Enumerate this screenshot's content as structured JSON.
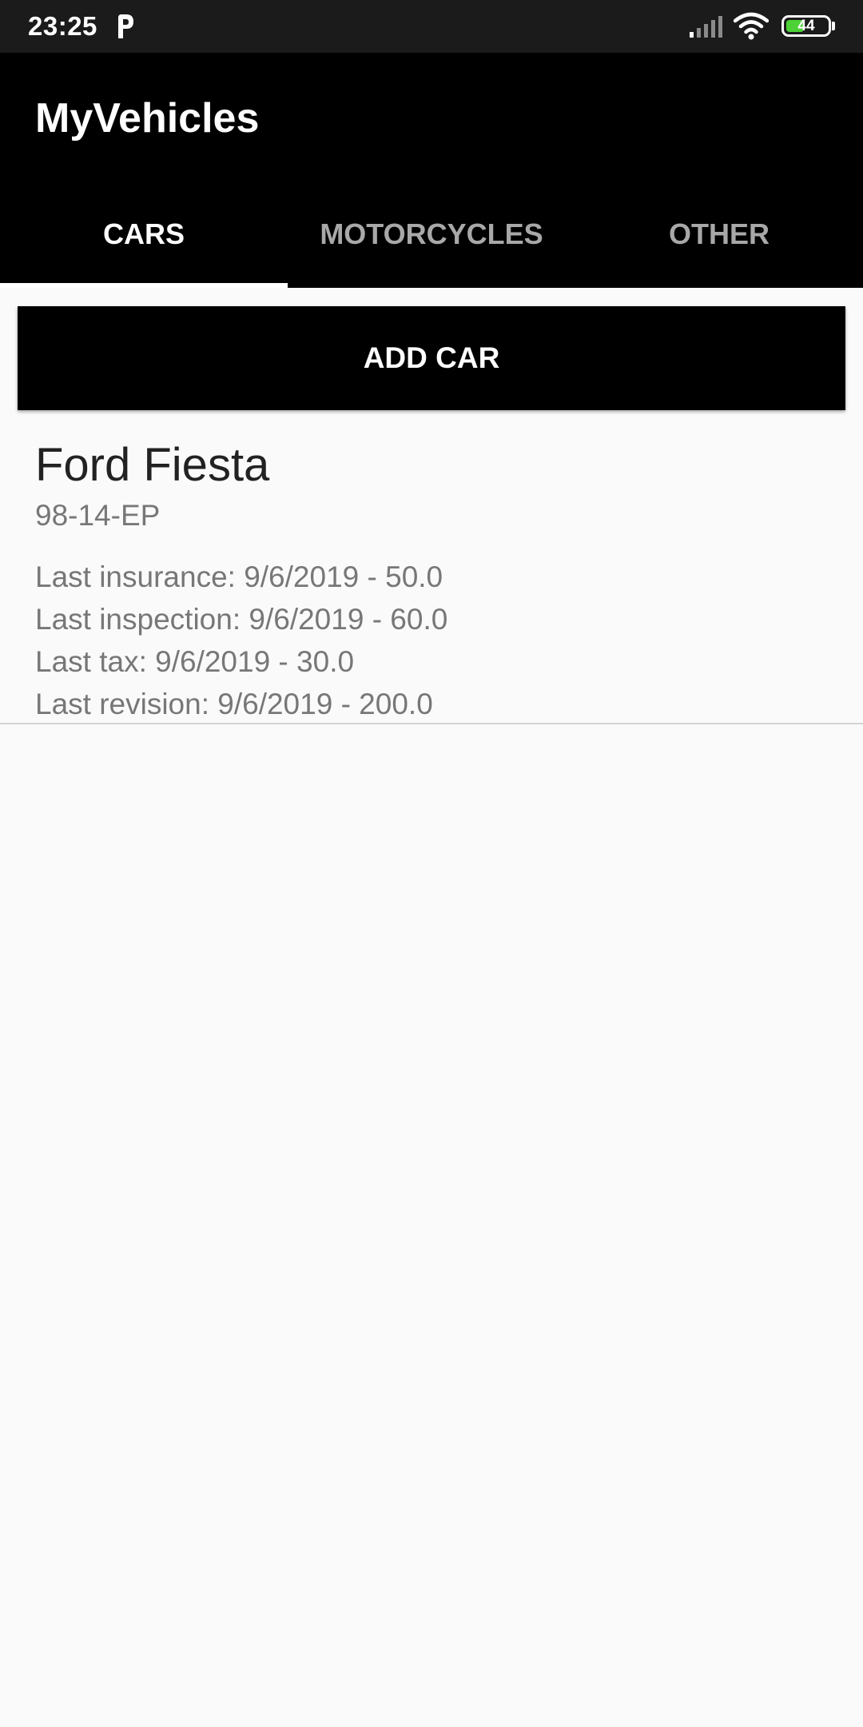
{
  "status_bar": {
    "time": "23:25",
    "battery": "44",
    "battery_level": 0.44,
    "icons": [
      "parking-app-icon",
      "signal-icon",
      "wifi-icon",
      "battery-icon"
    ]
  },
  "app_bar": {
    "title": "MyVehicles"
  },
  "tabs": [
    {
      "label": "CARS",
      "active": true
    },
    {
      "label": "MOTORCYCLES",
      "active": false
    },
    {
      "label": "OTHER",
      "active": false
    }
  ],
  "add_button": {
    "label": "ADD CAR"
  },
  "cars": [
    {
      "name": "Ford Fiesta",
      "plate": "98-14-EP",
      "details": [
        "Last insurance: 9/6/2019 - 50.0",
        "Last inspection: 9/6/2019 - 60.0",
        "Last tax: 9/6/2019 - 30.0",
        "Last revision: 9/6/2019 - 200.0"
      ]
    }
  ],
  "colors": {
    "app_bar_bg": "#000000",
    "status_bar_bg": "#1b1b1b",
    "background": "#fafafa",
    "battery_fill": "#4cd137"
  }
}
